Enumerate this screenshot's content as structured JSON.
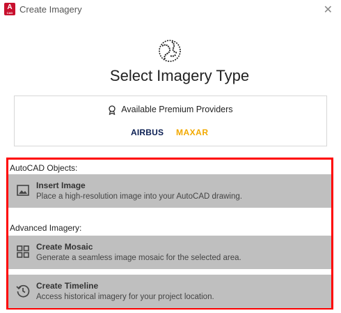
{
  "window": {
    "title": "Create Imagery",
    "close_glyph": "✕",
    "app_icon_letter": "A",
    "app_icon_sub": "CAD"
  },
  "main": {
    "heading": "Select Imagery Type",
    "providers": {
      "title": "Available Premium Providers",
      "logos": [
        "AIRBUS",
        "MAXAR"
      ]
    }
  },
  "sections": [
    {
      "label": "AutoCAD Objects:",
      "items": [
        {
          "title": "Insert Image",
          "description": "Place a high-resolution image into your AutoCAD drawing.",
          "icon": "image-icon"
        }
      ]
    },
    {
      "label": "Advanced Imagery:",
      "items": [
        {
          "title": "Create Mosaic",
          "description": "Generate a seamless image mosaic for the selected area.",
          "icon": "grid-icon"
        },
        {
          "title": "Create Timeline",
          "description": "Access historical imagery for your project location.",
          "icon": "history-icon"
        }
      ]
    }
  ],
  "colors": {
    "highlight_border": "#ff0000",
    "option_background": "#bfbfbf",
    "app_icon": "#c8102e",
    "airbus": "#0a1e52",
    "maxar": "#f2a900"
  }
}
